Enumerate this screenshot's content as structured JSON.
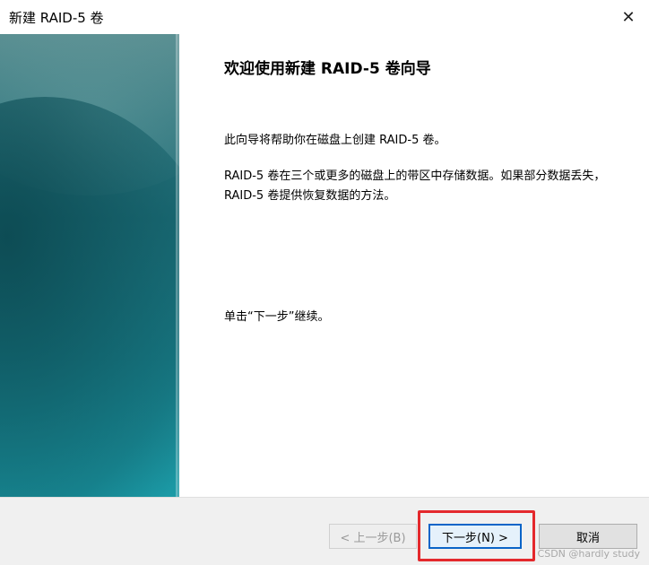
{
  "window": {
    "title": "新建 RAID-5 卷",
    "close_icon": "close-icon"
  },
  "content": {
    "heading": "欢迎使用新建 RAID-5 卷向导",
    "paragraph1": "此向导将帮助你在磁盘上创建 RAID-5 卷。",
    "paragraph2": "RAID-5 卷在三个或更多的磁盘上的带区中存储数据。如果部分数据丢失，RAID-5 卷提供恢复数据的方法。",
    "paragraph3": "单击“下一步”继续。"
  },
  "buttons": {
    "back": "< 上一步(B)",
    "next": "下一步(N) >",
    "cancel": "取消"
  },
  "watermark": "CSDN @hardly study",
  "colors": {
    "accent": "#0a64c8",
    "highlight": "#e4282c",
    "banner": "#1f6e78"
  }
}
